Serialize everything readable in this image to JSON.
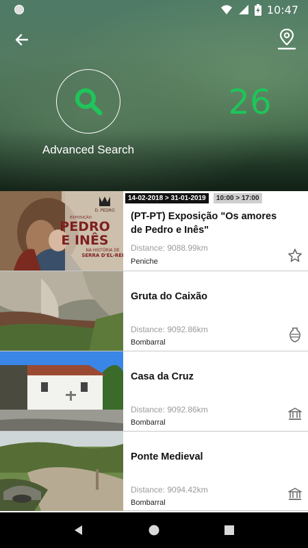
{
  "status_bar": {
    "time": "10:47"
  },
  "header": {
    "advanced_search_label": "Advanced Search",
    "result_count": "26",
    "accent_color": "#1fc45a"
  },
  "icons": {
    "back": "arrow-left-icon",
    "map": "map-pin-icon",
    "search": "search-icon",
    "favorite": "star-icon",
    "archaeology": "amphora-icon",
    "monument": "museum-icon"
  },
  "items": [
    {
      "date_range": "14-02-2018 > 31-01-2019",
      "time_range": "10:00 > 17:00",
      "title": "(PT-PT) Exposição \"Os amores de Pedro e Inês\"",
      "distance": "Distance: 9088.99km",
      "location": "Peniche",
      "icon": "star-icon",
      "thumb_text": {
        "brand": "D. PEDRO",
        "caption": "EXPOSIÇÃO",
        "line1": "PEDRO",
        "line2": "E INÊS",
        "sub1": "NA HISTÓRIA DE",
        "sub2": "SERRA D'EL-REI"
      }
    },
    {
      "title": "Gruta do Caixão",
      "distance": "Distance: 9092.86km",
      "location": "Bombarral",
      "icon": "amphora-icon"
    },
    {
      "title": "Casa da Cruz",
      "distance": "Distance: 9092.86km",
      "location": "Bombarral",
      "icon": "museum-icon"
    },
    {
      "title": "Ponte Medieval",
      "distance": "Distance: 9094.42km",
      "location": "Bombarral",
      "icon": "museum-icon"
    }
  ]
}
